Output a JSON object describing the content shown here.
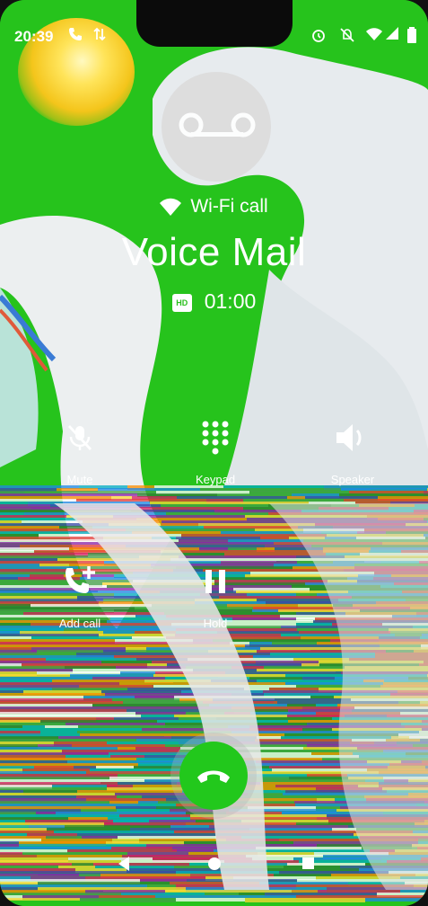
{
  "status_bar": {
    "time": "20:39",
    "left_icons": [
      "phone-call-icon",
      "data-icon"
    ],
    "right_icons": [
      "alarm-icon",
      "mute-notifications-icon",
      "wifi-icon",
      "signal-icon",
      "battery-icon"
    ]
  },
  "call": {
    "connection_label": "Wi-Fi call",
    "caller_name": "Voice Mail",
    "hd_badge": "HD",
    "duration": "01:00",
    "avatar_icon": "voicemail-icon"
  },
  "controls": {
    "mute": "Mute",
    "keypad": "Keypad",
    "speaker": "Speaker",
    "add_call": "Add call",
    "hold": "Hold"
  },
  "end_call_icon": "end-call-icon",
  "nav": [
    "back-icon",
    "home-icon",
    "recents-icon"
  ],
  "colors": {
    "accent_green": "#25c21b",
    "end_call": "#22c81c",
    "text": "#ffffff"
  }
}
